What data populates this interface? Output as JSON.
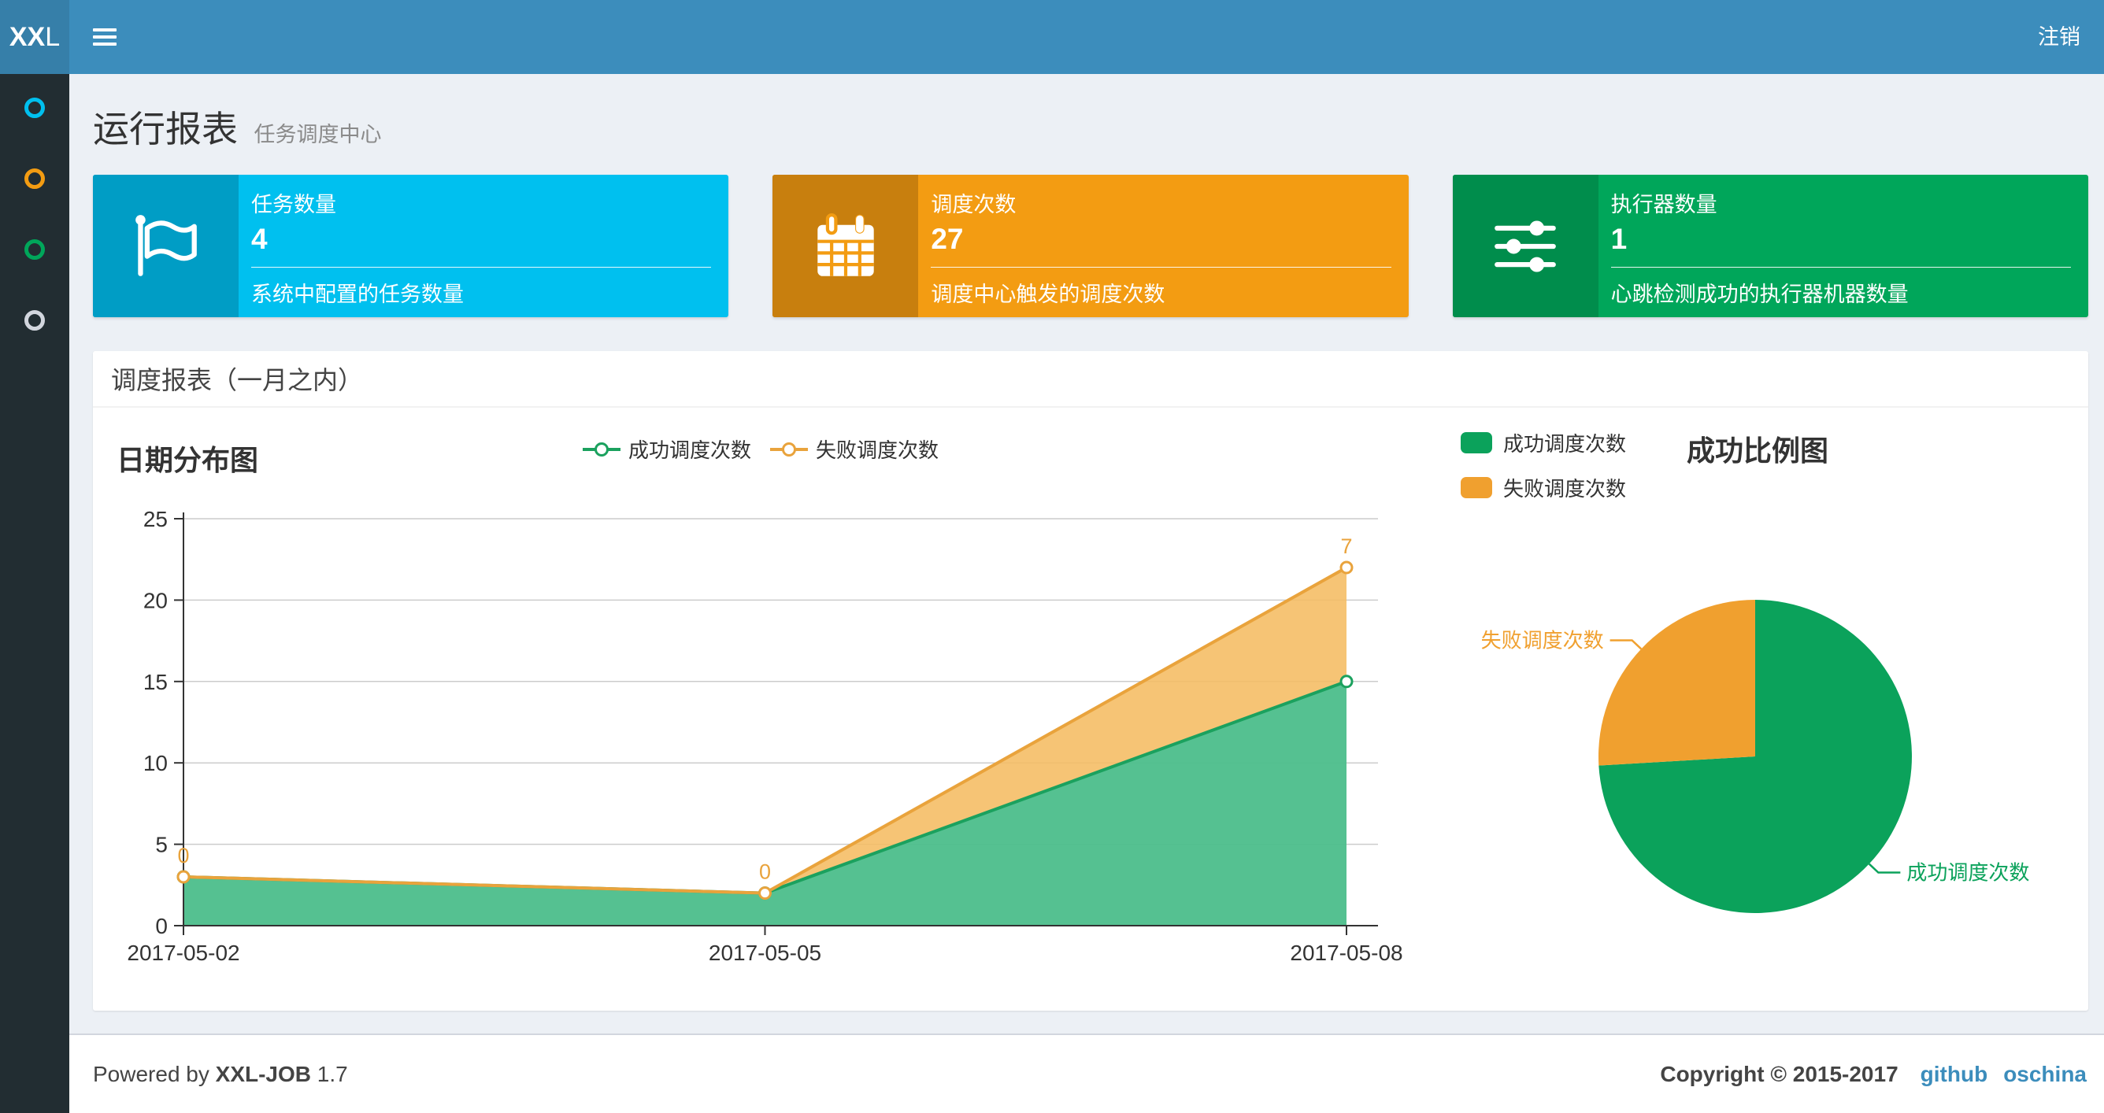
{
  "navbar": {
    "logo_bold": "XX",
    "logo_rest": "L",
    "logout_label": "注销"
  },
  "sidebar": {
    "items": [
      {
        "name": "menu-dashboard",
        "color": "#00c0ef"
      },
      {
        "name": "menu-job",
        "color": "#f39c12"
      },
      {
        "name": "menu-executor",
        "color": "#00a65a"
      },
      {
        "name": "menu-help",
        "color": "#d2d6de"
      }
    ]
  },
  "page_header": {
    "title": "运行报表",
    "subtitle": "任务调度中心"
  },
  "info_boxes": [
    {
      "label": "任务数量",
      "value": "4",
      "description": "系统中配置的任务数量",
      "color": "#00c0ef",
      "icon_color": "#009dc5",
      "icon": "flag-icon"
    },
    {
      "label": "调度次数",
      "value": "27",
      "description": "调度中心触发的调度次数",
      "color": "#f39c12",
      "icon_color": "#c standing",
      "icon": "calendar-icon"
    },
    {
      "label": "执行器数量",
      "value": "1",
      "description": "心跳检测成功的执行器机器数量",
      "color": "#00a65a",
      "icon_color": "#008d4c",
      "icon": "sliders-icon"
    }
  ],
  "panel": {
    "title": "调度报表（一月之内）"
  },
  "chart_data": [
    {
      "type": "area",
      "title": "日期分布图",
      "categories": [
        "2017-05-02",
        "2017-05-05",
        "2017-05-08"
      ],
      "series": [
        {
          "name": "成功调度次数",
          "values": [
            3,
            2,
            15
          ],
          "color": "#1ba15e",
          "fill": "rgba(76,190,139,0.95)"
        },
        {
          "name": "失败调度次数",
          "values": [
            0,
            0,
            7
          ],
          "color": "#e9a33c",
          "fill": "rgba(245,188,98,0.88)"
        }
      ],
      "stacked": true,
      "labels_on_top_series": [
        0,
        0,
        7
      ],
      "ylim": [
        0,
        25
      ],
      "yticks": [
        0,
        5,
        10,
        15,
        20,
        25
      ],
      "grid": true,
      "legend_position": "top-center"
    },
    {
      "type": "pie",
      "title": "成功比例图",
      "slices": [
        {
          "name": "成功调度次数",
          "value": 20,
          "color": "#0ba25b"
        },
        {
          "name": "失败调度次数",
          "value": 7,
          "color": "#f0a02f"
        }
      ],
      "legend_position": "top-left"
    }
  ],
  "footer": {
    "powered_prefix": "Powered by",
    "product": "XXL-JOB",
    "version": "1.7",
    "copyright": "Copyright © 2015-2017",
    "links": [
      {
        "label": "github"
      },
      {
        "label": "oschina"
      }
    ]
  }
}
